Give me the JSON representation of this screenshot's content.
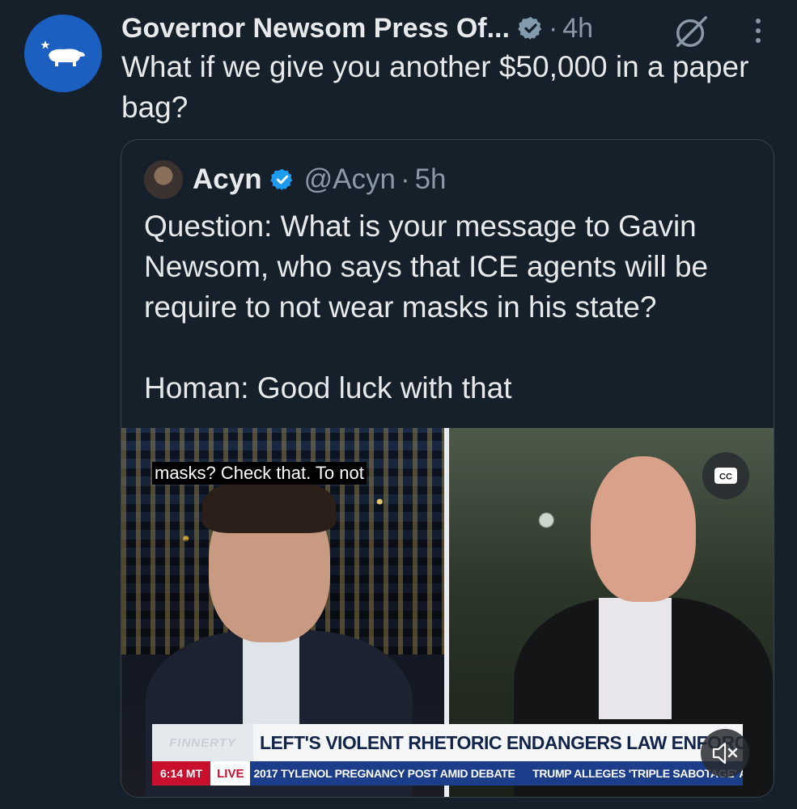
{
  "post": {
    "author_name": "Governor Newsom Press Of...",
    "separator": "·",
    "time": "4h",
    "text": "What if we give you another $50,000 in a paper bag?",
    "avatar_icon": "california-bear-icon",
    "avatar_color": "#1b5fc1"
  },
  "quoted": {
    "author_name": "Acyn",
    "handle": "@Acyn",
    "separator": "·",
    "time": "5h",
    "text": "Question: What is your message to Gavin Newsom, who says that ICE agents will be require to not wear masks in his state?\n\nHoman: Good luck with that",
    "verified_color": "#1d9bf0"
  },
  "video": {
    "caption": "masks? Check that. To not",
    "cc_label": "CC",
    "show_name": "FINNERTY",
    "headline": "LEFT'S VIOLENT RHETORIC ENDANGERS LAW ENFORCEMENT",
    "ticker_time": "6:14 MT",
    "ticker_live": "LIVE",
    "ticker_text": "2017 TYLENOL PREGNANCY POST AMID DEBATE      TRUMP ALLEGES 'TRIPLE SABOTAGE' AT UN"
  },
  "colors": {
    "background": "#15202b",
    "text": "#e7e9ea",
    "secondary_text": "#8b98a5",
    "border": "#38444d"
  }
}
